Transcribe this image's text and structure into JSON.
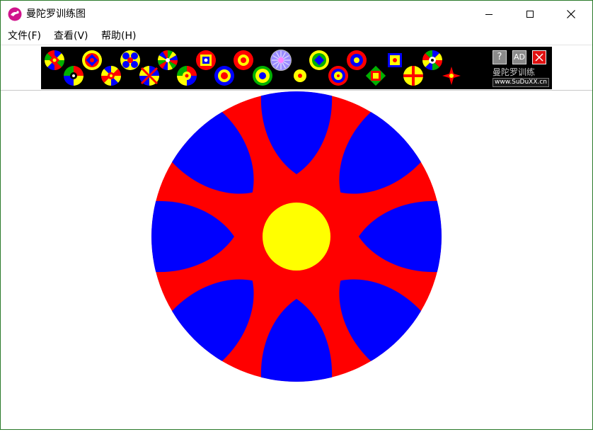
{
  "window": {
    "title": "曼陀罗训练图",
    "border_color": "#2b7a2b",
    "controls": {
      "minimize_icon": "minimize-icon",
      "maximize_icon": "maximize-icon",
      "close_icon": "close-icon"
    }
  },
  "menu": {
    "items": [
      "文件(F)",
      "查看(V)",
      "帮助(H)"
    ]
  },
  "toolbar": {
    "pattern_count": 22,
    "selected_pattern": 12,
    "help_label": "?",
    "ad_label": "AD",
    "exit_icon": "exit-icon",
    "brand_name": "曼陀罗训练",
    "brand_url": "www.SuDuXX.cn"
  },
  "mandala": {
    "spokes": 8,
    "colors": {
      "outer": "#0000ff",
      "spokes": "#ff0000",
      "center": "#ffff00"
    }
  }
}
